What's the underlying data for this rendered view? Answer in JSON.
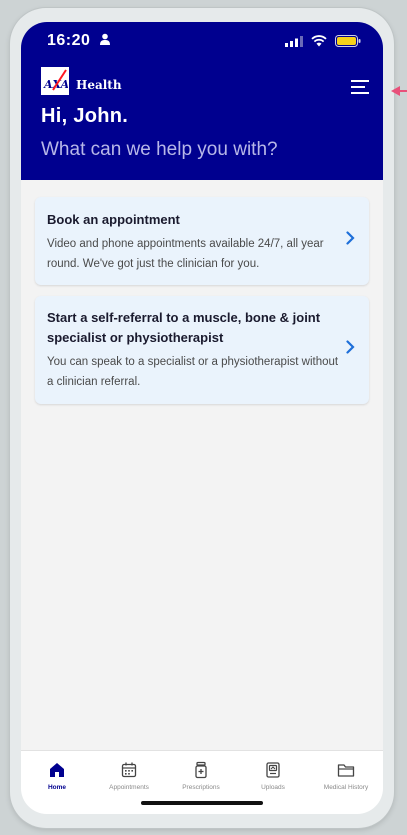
{
  "status": {
    "time": "16:20"
  },
  "header": {
    "brand_logo": "AXA",
    "brand_name": "Health",
    "greeting": "Hi, John.",
    "subtitle": "What can we help you with?",
    "background": "#00008f"
  },
  "cards": [
    {
      "title": "Book an appointment",
      "description": "Video and phone appointments available 24/7, all year round. We've got just the clinician for you."
    },
    {
      "title": "Start a self-referral to a muscle, bone & joint specialist or physiotherapist",
      "description": "You can speak to a specialist or a physiotherapist without a clinician referral."
    }
  ],
  "tabs": [
    {
      "label": "Home",
      "icon": "home-icon",
      "active": true
    },
    {
      "label": "Appointments",
      "icon": "calendar-icon",
      "active": false
    },
    {
      "label": "Prescriptions",
      "icon": "prescription-icon",
      "active": false
    },
    {
      "label": "Uploads",
      "icon": "upload-icon",
      "active": false
    },
    {
      "label": "Medical History",
      "icon": "folder-icon",
      "active": false
    }
  ],
  "colors": {
    "accent": "#00008f",
    "card_bg": "#eaf3fc",
    "chevron": "#1e6fd9",
    "pointer": "#e8507a"
  }
}
